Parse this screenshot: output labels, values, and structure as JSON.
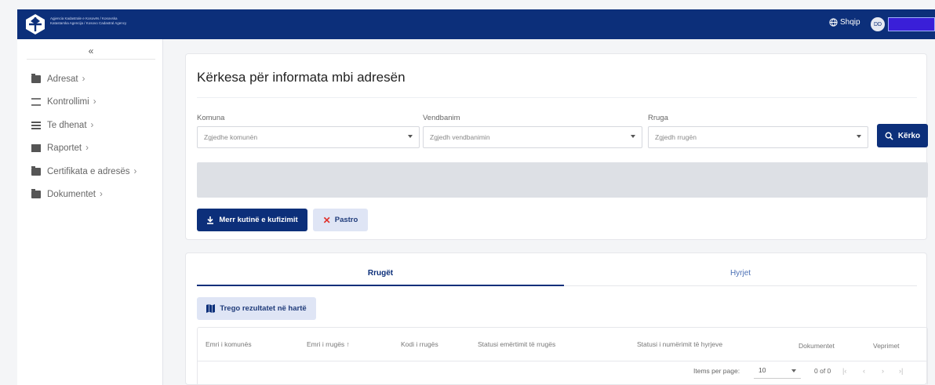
{
  "header": {
    "logo_text": "Agjencia Kadastrale e Kosovës / Kosovska Katastarska Agencija / Kosovo Cadastral Agency",
    "language": "Shqip",
    "avatar_initials": "DD",
    "brand_color": "#0c2f7a"
  },
  "sidebar": {
    "collapse_label": "«",
    "items": [
      {
        "label": "Adresat",
        "icon": "folder-icon"
      },
      {
        "label": "Kontrollimi",
        "icon": "filter-icon"
      },
      {
        "label": "Te dhenat",
        "icon": "list-icon"
      },
      {
        "label": "Raportet",
        "icon": "chart-icon"
      },
      {
        "label": "Certifikata e adresës",
        "icon": "folder-icon"
      },
      {
        "label": "Dokumentet",
        "icon": "folder-icon"
      }
    ]
  },
  "search": {
    "title": "Kërkesa për informata mbi adresën",
    "komuna_label": "Komuna",
    "komuna_placeholder": "Zgjedhe komunën",
    "vendbanim_label": "Vendbanim",
    "vendbanim_placeholder": "Zgjedh vendbanimin",
    "rruga_label": "Rruga",
    "rruga_placeholder": "Zgjedh rrugën",
    "search_button": "Kërko",
    "boundary_button": "Merr kutinë e kufizimit",
    "clear_button": "Pastro"
  },
  "results": {
    "tabs": [
      "Rrugët",
      "Hyrjet"
    ],
    "map_button": "Trego rezultatet në hartë",
    "columns": [
      "Emri i komunës",
      "Emri i rrugës ↑",
      "Kodi i rrugës",
      "Statusi emërtimit të rrugës",
      "Statusi i numërimit të hyrjeve",
      "Dokumentet",
      "Veprimet"
    ],
    "items_per_page_label": "Items per page:",
    "items_per_page_value": "10",
    "range_label": "0 of 0"
  }
}
